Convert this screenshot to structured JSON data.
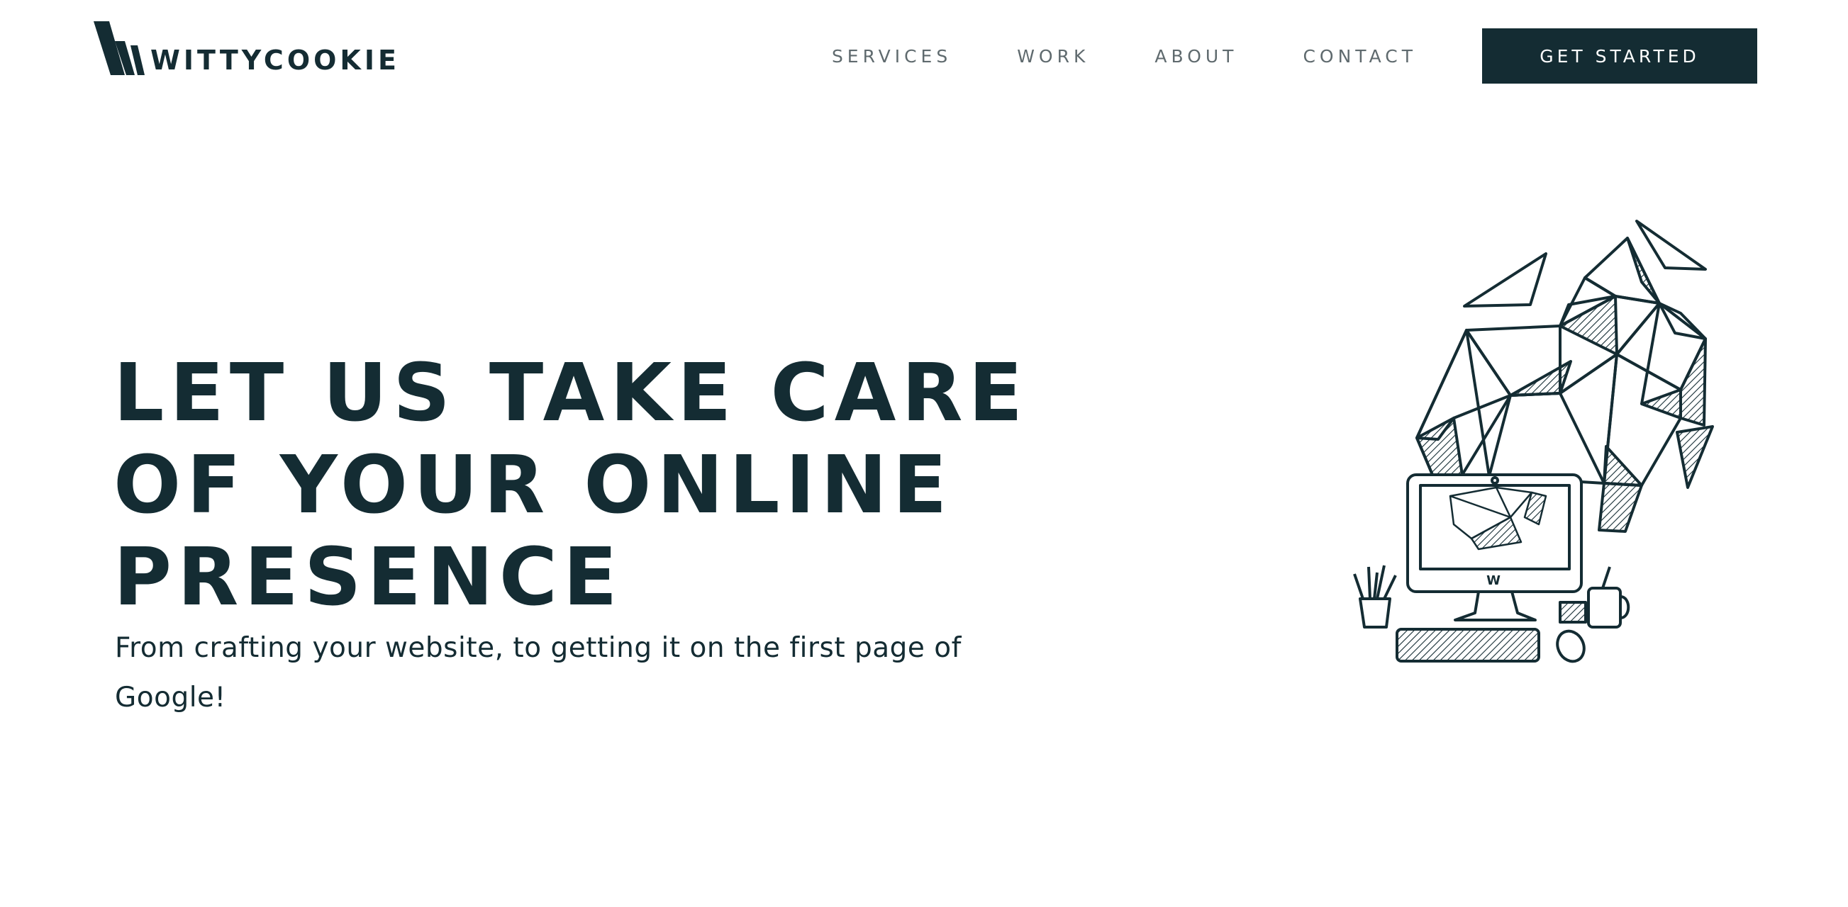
{
  "brand": {
    "name": "WITTYCOOKIE",
    "color": "#142c33"
  },
  "nav": {
    "items": [
      {
        "label": "SERVICES"
      },
      {
        "label": "WORK"
      },
      {
        "label": "ABOUT"
      },
      {
        "label": "CONTACT"
      }
    ],
    "cta_label": "GET STARTED"
  },
  "hero": {
    "title_lines": [
      "LET US TAKE CARE",
      "OF YOUR ONLINE",
      "PRESENCE"
    ],
    "subtitle": "From crafting your website, to getting it on the first page of Google!"
  },
  "illustration": {
    "icon": "geometric-desk-illustration",
    "screen_logo": "W"
  }
}
